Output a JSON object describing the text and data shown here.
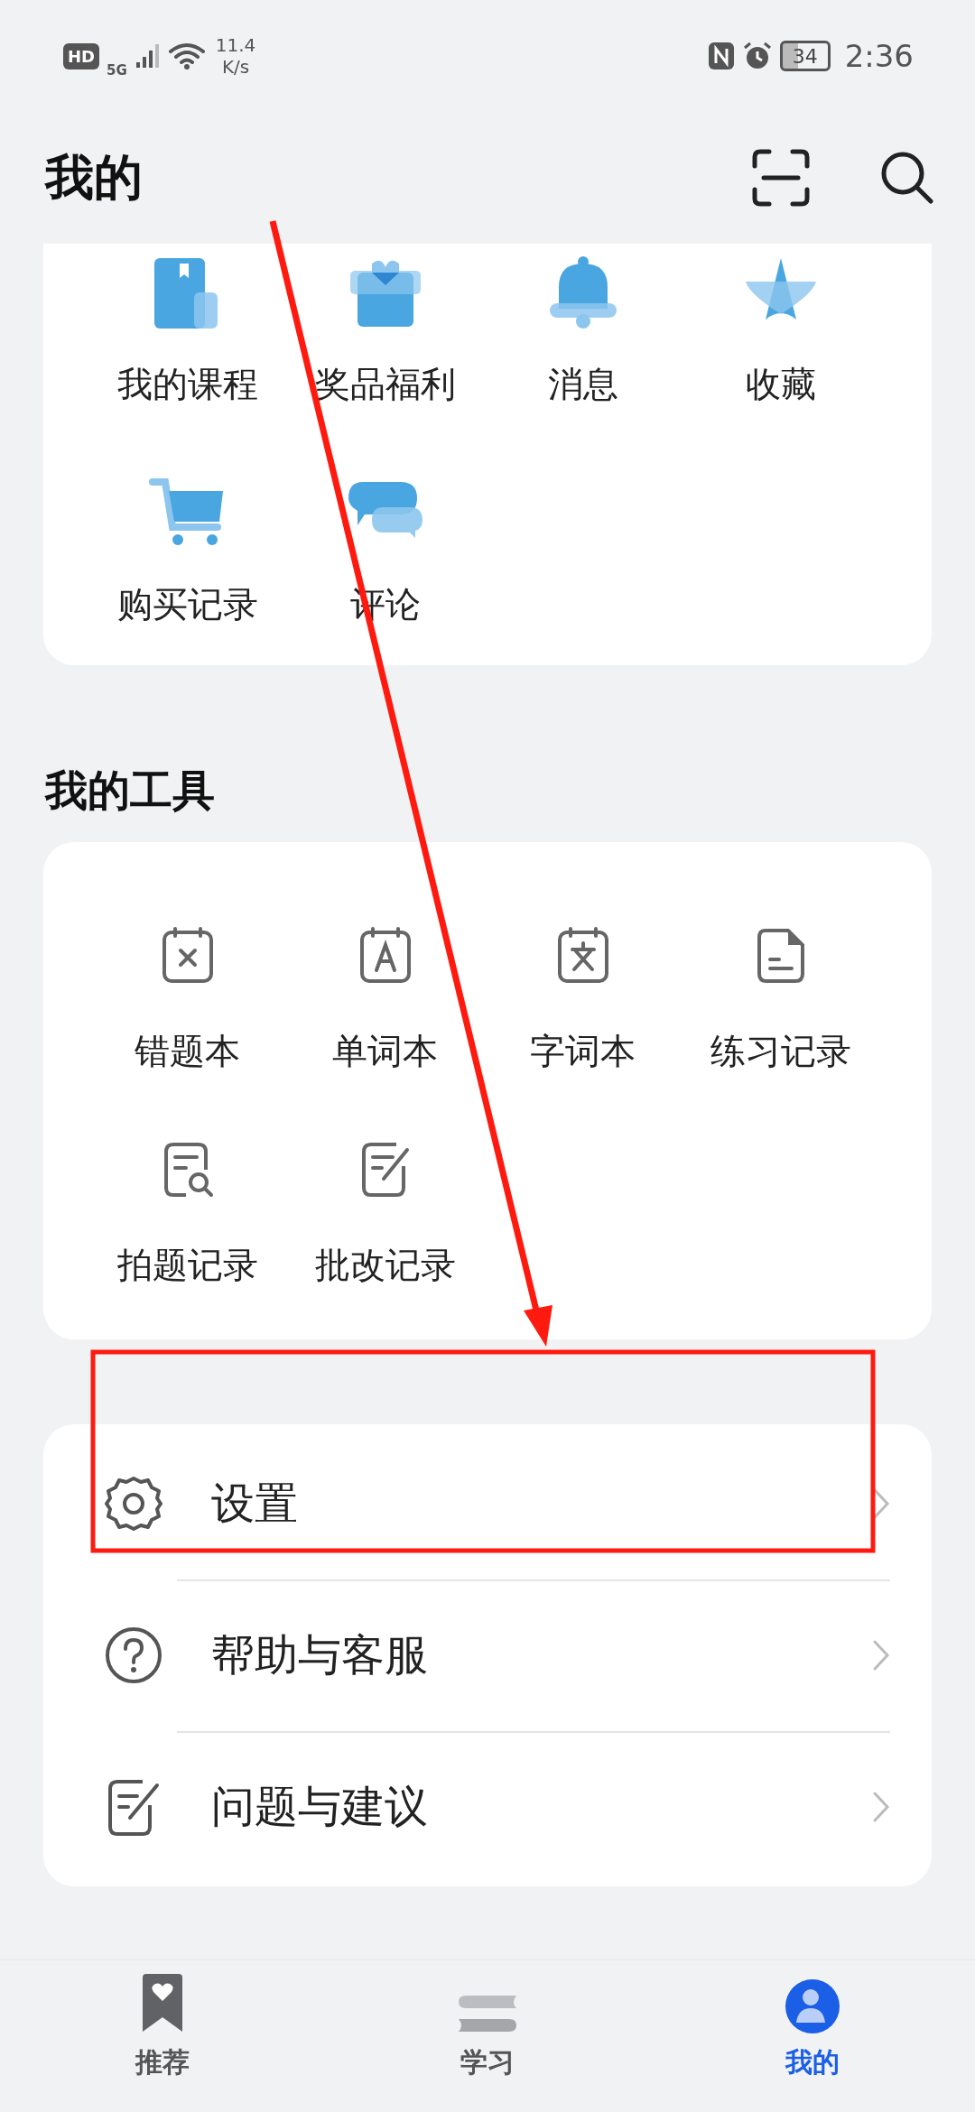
{
  "status_bar": {
    "hd": "HD",
    "network": "5G",
    "speed_value": "11.4",
    "speed_unit": "K/s",
    "battery": "34",
    "time": "2:36"
  },
  "header": {
    "title": "我的"
  },
  "services": [
    {
      "label": "我的课程"
    },
    {
      "label": "奖品福利"
    },
    {
      "label": "消息"
    },
    {
      "label": "收藏"
    },
    {
      "label": "购买记录"
    },
    {
      "label": "评论"
    }
  ],
  "tools": {
    "title": "我的工具",
    "items": [
      {
        "label": "错题本"
      },
      {
        "label": "单词本"
      },
      {
        "label": "字词本"
      },
      {
        "label": "练习记录"
      },
      {
        "label": "拍题记录"
      },
      {
        "label": "批改记录"
      }
    ]
  },
  "menu": [
    {
      "label": "设置"
    },
    {
      "label": "帮助与客服"
    },
    {
      "label": "问题与建议"
    }
  ],
  "tab_bar": [
    {
      "label": "推荐",
      "selected": false
    },
    {
      "label": "学习",
      "selected": false
    },
    {
      "label": "我的",
      "selected": true
    }
  ],
  "annotations": {
    "arrow": {
      "color": "#ff1a10"
    },
    "box": {
      "color": "#ff1a10"
    }
  }
}
